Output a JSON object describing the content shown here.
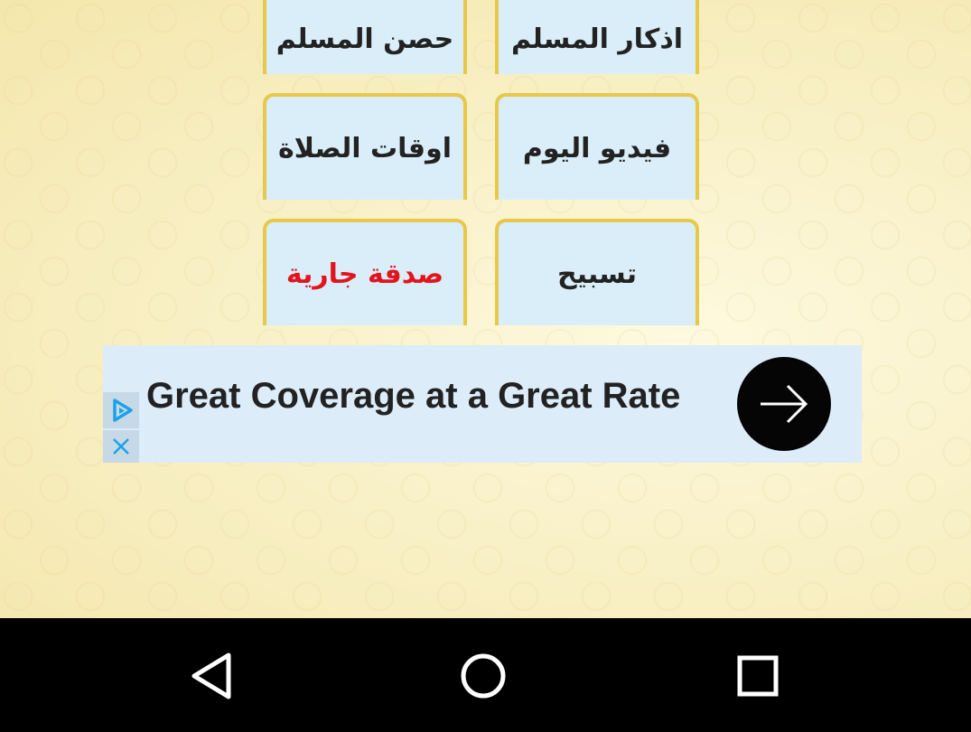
{
  "tiles": {
    "hisn_muslim": "حصن المسلم",
    "azkar_muslim": "اذكار المسلم",
    "prayer_times": "اوقات الصلاة",
    "video_today": "فيديو اليوم",
    "sadaqa_jariya": "صدقة جارية",
    "tasbeeh": "تسبيح"
  },
  "ad": {
    "headline": "Great Coverage at a Great Rate",
    "choices_icon": "adchoices-icon",
    "close_icon": "close-icon",
    "arrow_icon": "arrow-right-icon"
  },
  "colors": {
    "tile_bg": "#d9eef8",
    "tile_border": "#e8c84a",
    "highlight_text": "#e3141e",
    "ad_bg": "#dcecf8"
  },
  "navbar": {
    "back_icon": "back-triangle-icon",
    "home_icon": "home-circle-icon",
    "recents_icon": "recents-square-icon"
  }
}
